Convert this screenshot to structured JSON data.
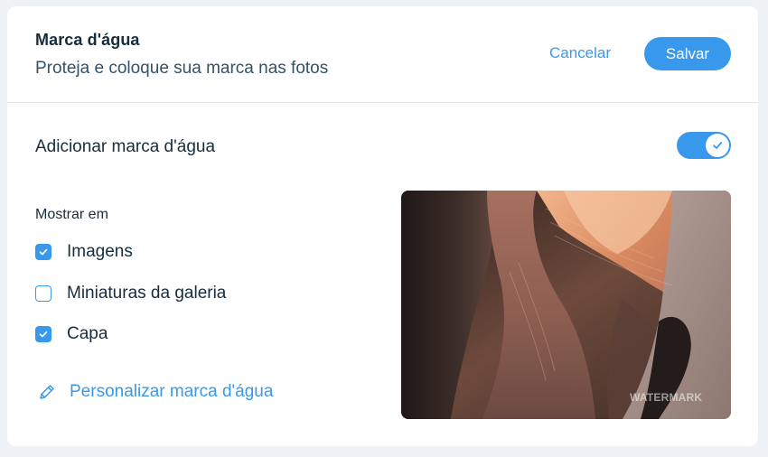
{
  "header": {
    "title": "Marca d'água",
    "subtitle": "Proteja e coloque sua marca nas fotos",
    "cancel_label": "Cancelar",
    "save_label": "Salvar"
  },
  "watermark_toggle": {
    "label": "Adicionar marca d'água",
    "enabled": true
  },
  "show_in": {
    "label": "Mostrar em",
    "options": [
      {
        "label": "Imagens",
        "checked": true
      },
      {
        "label": "Miniaturas da galeria",
        "checked": false
      },
      {
        "label": "Capa",
        "checked": true
      }
    ]
  },
  "customize": {
    "label": "Personalizar marca d'água",
    "icon": "pencil-icon"
  },
  "preview": {
    "watermark_text": "WATERMARK"
  },
  "colors": {
    "accent": "#3899ec",
    "text": "#162d3d",
    "background": "#eef1f6"
  }
}
